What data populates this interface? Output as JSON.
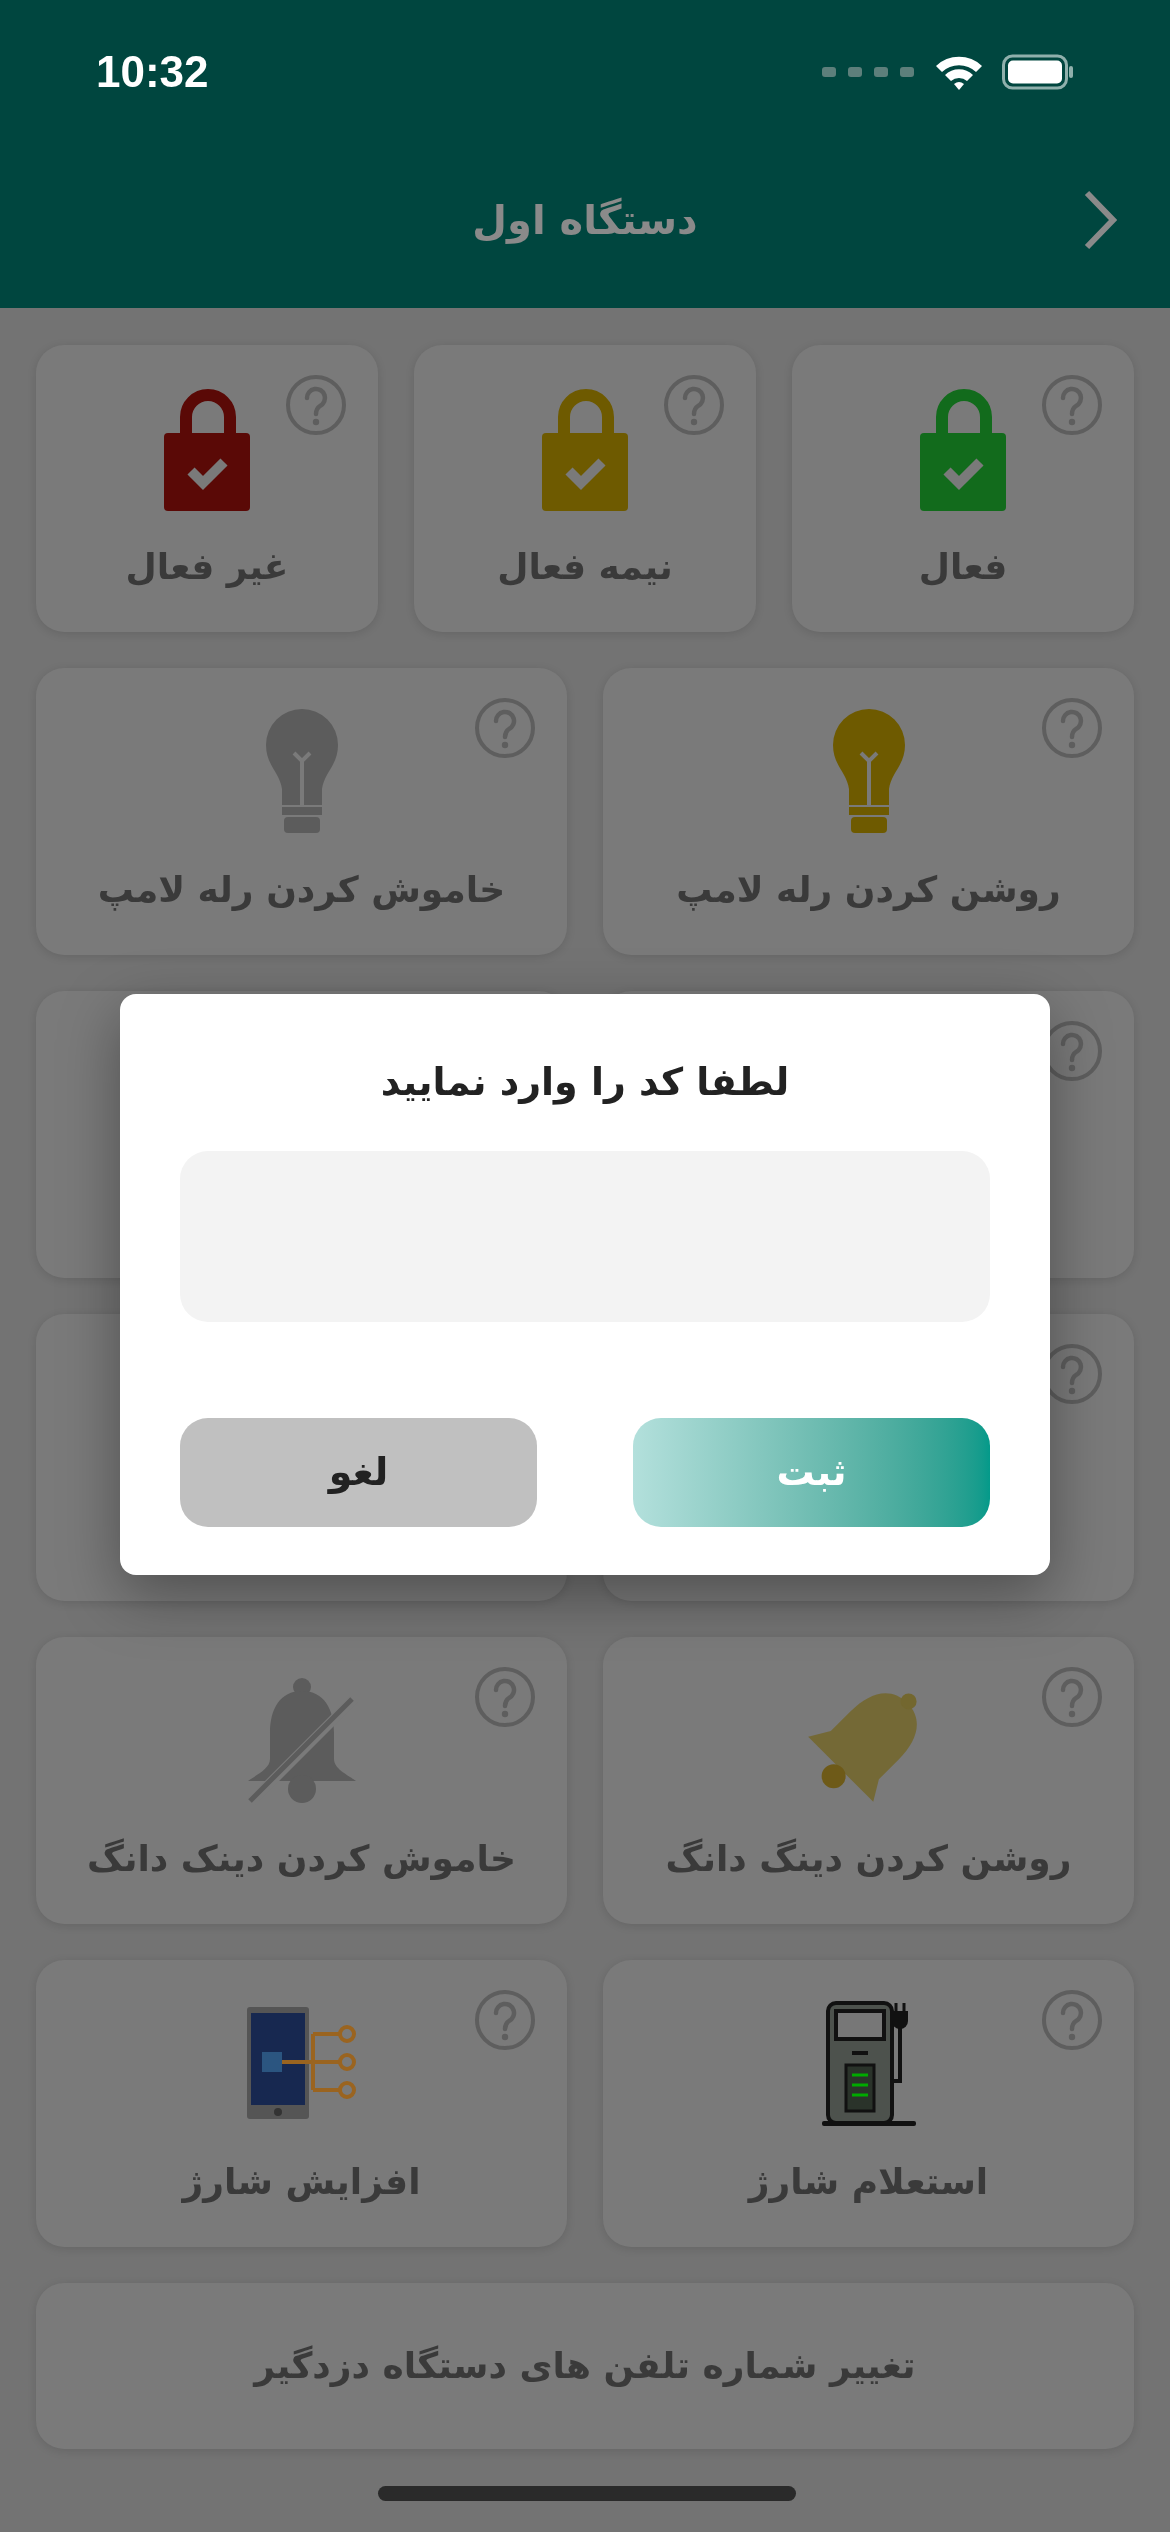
{
  "status_bar": {
    "time": "10:32"
  },
  "header": {
    "title": "دستگاه اول"
  },
  "rows": [
    [
      {
        "label": "فعال",
        "kind": "lock",
        "color": "#126b1c"
      },
      {
        "label": "نیمه فعال",
        "kind": "lock",
        "color": "#6e5a00"
      },
      {
        "label": "غیر فعال",
        "kind": "lock",
        "color": "#5a0906"
      }
    ],
    [
      {
        "label": "روشن کردن رله لامپ",
        "kind": "bulb",
        "color": "#6e5a00"
      },
      {
        "label": "خاموش کردن رله لامپ",
        "kind": "bulb",
        "color": "#5c5c5c"
      }
    ],
    [
      {
        "kind": "covered"
      },
      {
        "kind": "covered"
      }
    ],
    [
      {
        "kind": "covered"
      },
      {
        "kind": "covered"
      }
    ],
    [
      {
        "label": "روشن کردن دینگ دانگ",
        "kind": "bell"
      },
      {
        "label": "خاموش کردن دینک دانگ",
        "kind": "bell-off"
      }
    ],
    [
      {
        "label": "استعلام شارژ",
        "kind": "charger"
      },
      {
        "label": "افزایش شارژ",
        "kind": "phone-network"
      }
    ],
    [
      {
        "label": "تغییر شماره تلفن های دستگاه دزدگیر",
        "kind": "text"
      }
    ]
  ],
  "dialog": {
    "title": "لطفا کد را وارد نمایید",
    "buttons": [
      {
        "label": "ثبت",
        "kind": "primary"
      },
      {
        "label": "لغو",
        "kind": "secondary"
      }
    ]
  }
}
